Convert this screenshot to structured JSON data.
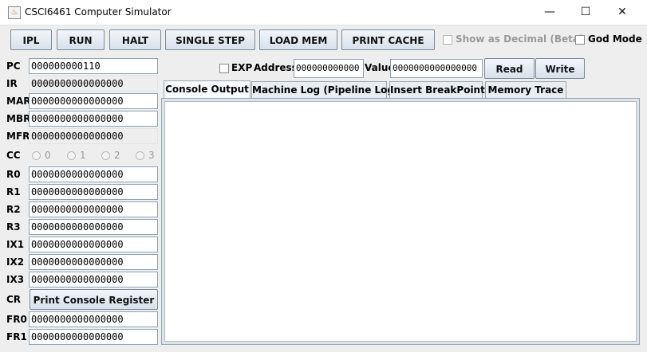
{
  "window": {
    "title": "CSCI6461 Computer Simulator",
    "minimize": "—",
    "maximize": "☐",
    "close": "✕"
  },
  "toolbar": {
    "ipl": "IPL",
    "run": "RUN",
    "halt": "HALT",
    "single_step": "SINGLE STEP",
    "load_mem": "LOAD MEM",
    "print_cache": "PRINT CACHE",
    "show_decimal": "Show as Decimal (Beta)",
    "god_mode": "God Mode"
  },
  "exp": {
    "label": "EXP",
    "address_label": "Address",
    "address_value": "000000000000",
    "value_label": "Value",
    "value_value": "0000000000000000",
    "read": "Read",
    "write": "Write"
  },
  "registers": {
    "pc": {
      "label": "PC",
      "value": "000000000110"
    },
    "ir": {
      "label": "IR",
      "value": "0000000000000000"
    },
    "mar": {
      "label": "MAR",
      "value": "0000000000000000"
    },
    "mbr": {
      "label": "MBR",
      "value": "0000000000000000"
    },
    "mfr": {
      "label": "MFR",
      "value": "0000000000000000"
    },
    "cc": {
      "label": "CC",
      "options": [
        "0",
        "1",
        "2",
        "3"
      ]
    },
    "r0": {
      "label": "R0",
      "value": "0000000000000000"
    },
    "r1": {
      "label": "R1",
      "value": "0000000000000000"
    },
    "r2": {
      "label": "R2",
      "value": "0000000000000000"
    },
    "r3": {
      "label": "R3",
      "value": "0000000000000000"
    },
    "ix1": {
      "label": "IX1",
      "value": "0000000000000000"
    },
    "ix2": {
      "label": "IX2",
      "value": "0000000000000000"
    },
    "ix3": {
      "label": "IX3",
      "value": "0000000000000000"
    },
    "cr": {
      "label": "CR",
      "button": "Print Console Register"
    },
    "fr0": {
      "label": "FR0",
      "value": "0000000000000000"
    },
    "fr1": {
      "label": "FR1",
      "value": "0000000000000000"
    }
  },
  "tabs": [
    {
      "label": "Console Output"
    },
    {
      "label": "Machine Log (Pipeline Log)"
    },
    {
      "label": "Insert BreakPoint"
    },
    {
      "label": "Memory Trace"
    }
  ],
  "console": {
    "content": ""
  }
}
